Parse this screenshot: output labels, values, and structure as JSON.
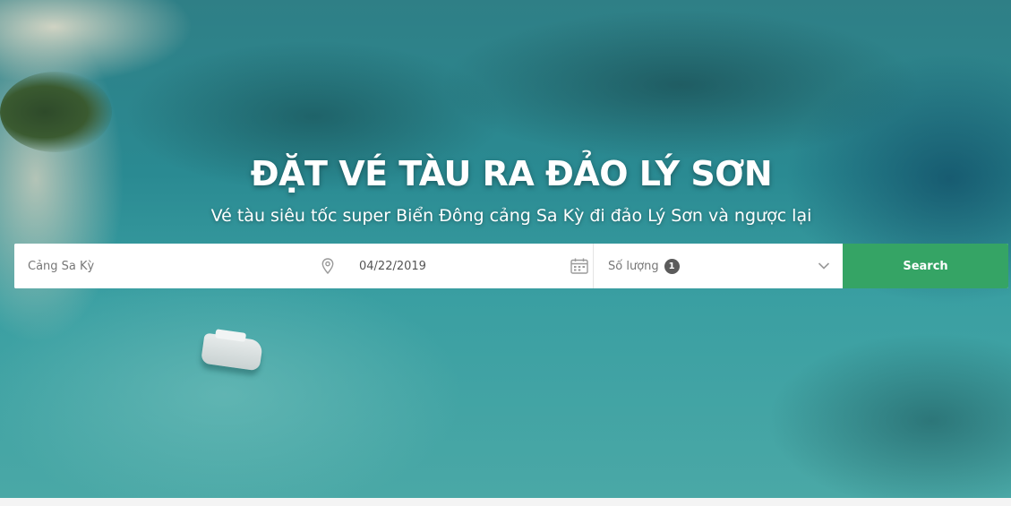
{
  "hero": {
    "title": "ĐẶT VÉ TÀU RA ĐẢO LÝ SƠN",
    "subtitle": "Vé tàu siêu tốc super Biển Đông cảng Sa Kỳ đi đảo Lý Sơn và ngược lại"
  },
  "search": {
    "location_value": "Cảng Sa Kỳ",
    "date_value": "04/22/2019",
    "quantity_label": "Số lượng",
    "quantity_count": "1",
    "button_label": "Search",
    "icons": {
      "location": "map-pin-icon",
      "date": "calendar-icon",
      "quantity": "chevron-down-icon"
    }
  },
  "colors": {
    "accent": "#35a465",
    "field_background": "#ffffff",
    "badge": "#5b5b5b"
  }
}
